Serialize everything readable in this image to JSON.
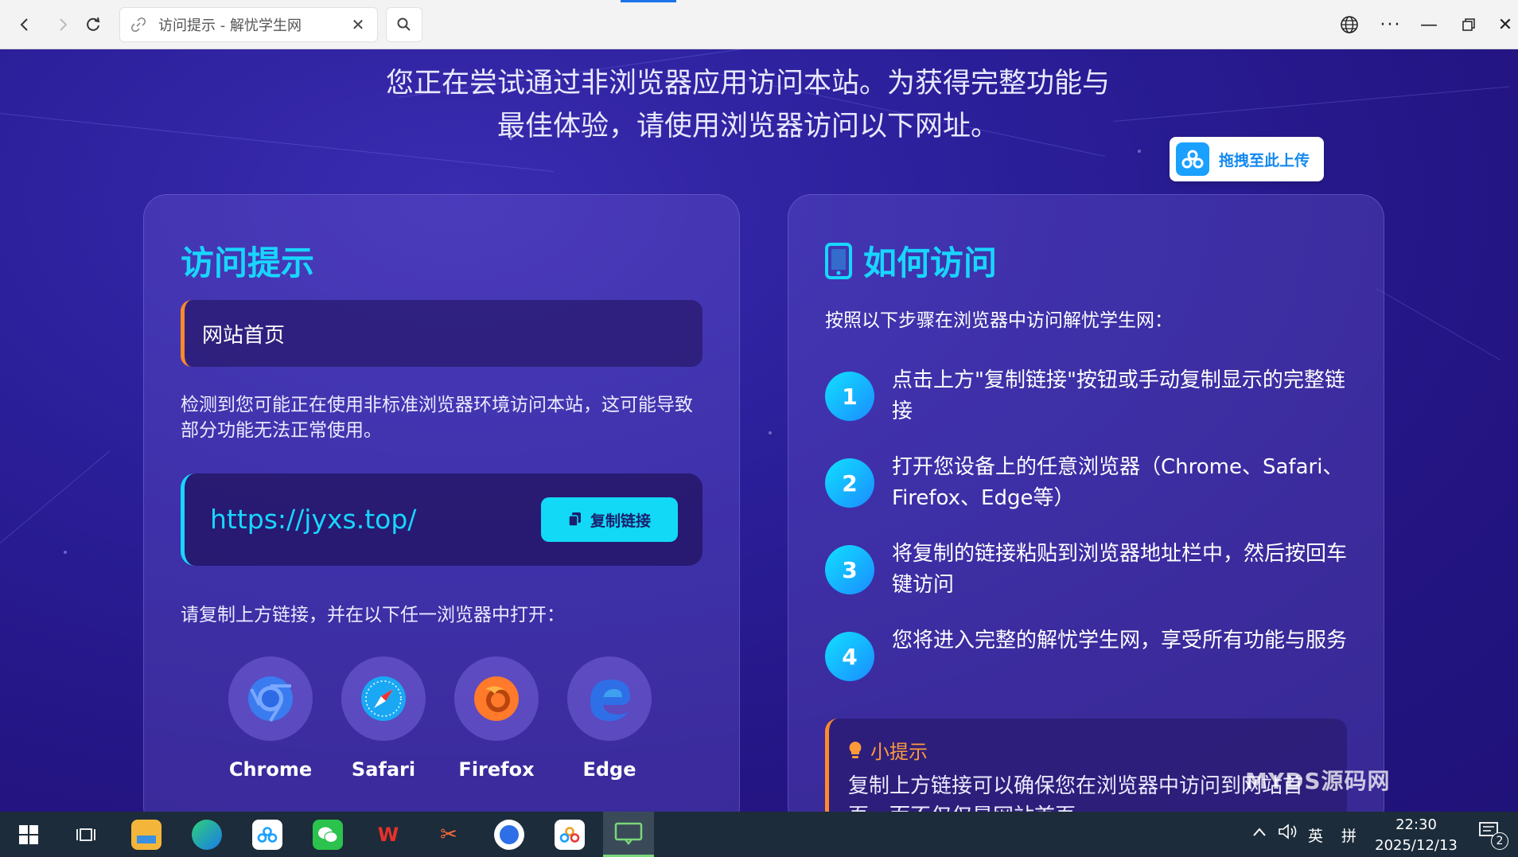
{
  "browser": {
    "tab_title": "访问提示 - 解忧学生网",
    "back_icon": "chevron-left-icon",
    "forward_icon": "chevron-right-icon",
    "refresh_icon": "refresh-icon",
    "search_icon": "search-icon"
  },
  "page": {
    "intro_line1": "您正在尝试通过非浏览器应用访问本站。为获得完整功能与",
    "intro_line2": "最佳体验，请使用浏览器访问以下网址。",
    "upload_label": "拖拽至此上传",
    "left_card": {
      "title": "访问提示",
      "homepage_label": "网站首页",
      "detect_text": "检测到您可能正在使用非标准浏览器环境访问本站，这可能导致部分功能无法正常使用。",
      "url": "https://jyxs.top/",
      "copy_label": "复制链接",
      "browsers_hint": "请复制上方链接，并在以下任一浏览器中打开：",
      "browsers": [
        {
          "name": "Chrome",
          "icon": "chrome-icon"
        },
        {
          "name": "Safari",
          "icon": "safari-icon"
        },
        {
          "name": "Firefox",
          "icon": "firefox-icon"
        },
        {
          "name": "Edge",
          "icon": "edge-icon"
        }
      ]
    },
    "right_card": {
      "title": "如何访问",
      "steps_intro": "按照以下步骤在浏览器中访问解忧学生网：",
      "steps": [
        {
          "num": "1",
          "text": "点击上方\"复制链接\"按钮或手动复制显示的完整链接"
        },
        {
          "num": "2",
          "text": "打开您设备上的任意浏览器（Chrome、Safari、Firefox、Edge等）"
        },
        {
          "num": "3",
          "text": "将复制的链接粘贴到浏览器地址栏中，然后按回车键访问"
        },
        {
          "num": "4",
          "text": "您将进入完整的解忧学生网，享受所有功能与服务"
        }
      ],
      "tip_title": "小提示",
      "tip_text": "复制上方链接可以确保您在浏览器中访问到网站首页，而不仅仅是网站首页"
    },
    "watermark": "MYDS源码网"
  },
  "taskbar": {
    "ime_label": "英",
    "ime_mode": "拼",
    "time": "22:30",
    "date": "2025/12/13",
    "notification_count": "2"
  },
  "colors": {
    "accent": "#18d6ff",
    "orange": "#ff8a2a",
    "bg": "#2a1a8a"
  }
}
